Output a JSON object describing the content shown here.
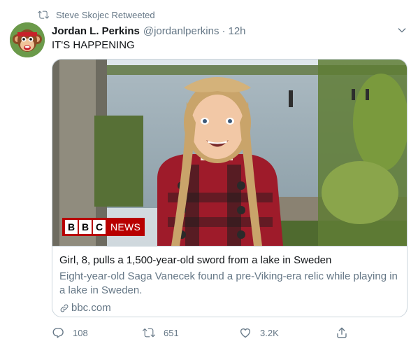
{
  "retweet": {
    "icon": "retweet-icon",
    "text": "Steve Skojec Retweeted"
  },
  "author": {
    "name": "Jordan L. Perkins",
    "handle": "@jordanlperkins",
    "separator": "·",
    "time": "12h",
    "avatar_icon": "monkey-avatar"
  },
  "menu": {
    "icon": "chevron-down-icon"
  },
  "tweet": {
    "text": "IT'S HAPPENING"
  },
  "card": {
    "logo_box": [
      "B",
      "B",
      "C"
    ],
    "logo_word": "NEWS",
    "title": "Girl, 8, pulls a 1,500-year-old sword from a lake in Sweden",
    "description": "Eight-year-old Saga Vanecek found a pre-Viking-era relic while playing in a lake in Sweden.",
    "domain": "bbc.com",
    "link_icon": "link-icon"
  },
  "actions": {
    "reply": {
      "icon": "reply-icon",
      "count": "108"
    },
    "retweet": {
      "icon": "retweet-icon",
      "count": "651"
    },
    "like": {
      "icon": "heart-icon",
      "count": "3.2K"
    },
    "share": {
      "icon": "share-icon"
    }
  },
  "colors": {
    "primary_text": "#14171a",
    "secondary_text": "#657786",
    "border": "#ccd6dd",
    "bbc_red": "#b80000"
  }
}
